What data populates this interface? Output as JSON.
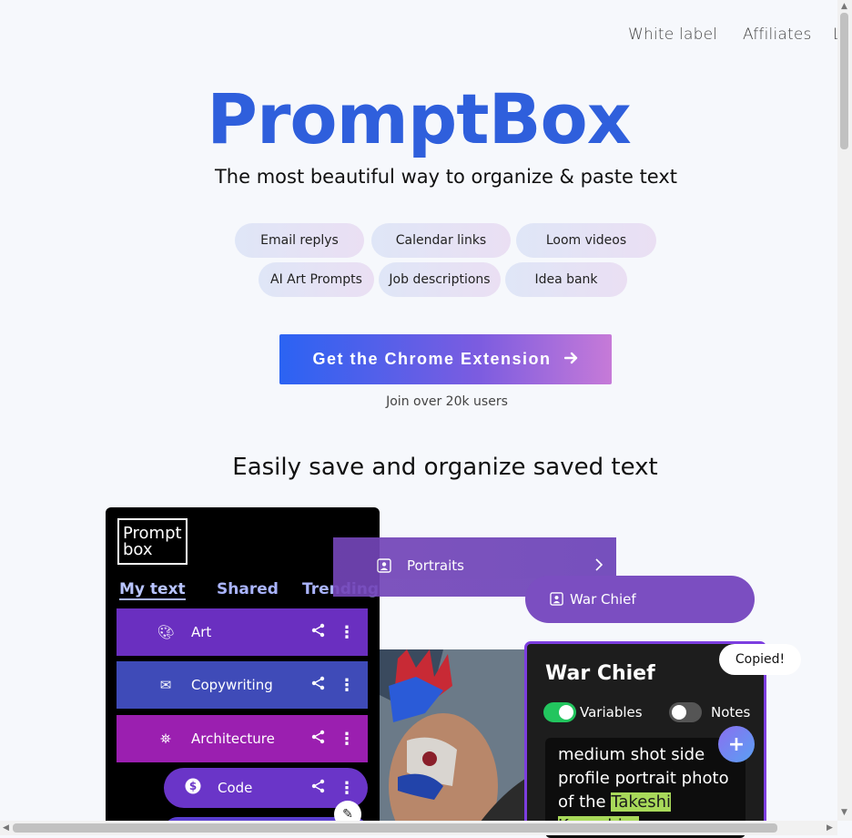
{
  "nav": {
    "items": [
      "White label",
      "Affiliates",
      "L"
    ]
  },
  "hero": {
    "logo": "PromptBox",
    "tagline": "The most beautiful way to organize & paste text",
    "chips_row1": [
      "Email replys",
      "Calendar links",
      "Loom videos"
    ],
    "chips_row2": [
      "AI Art Prompts",
      "Job descriptions",
      "Idea bank"
    ],
    "cta_label": "Get the Chrome Extension",
    "join_text": "Join over 20k users"
  },
  "section": {
    "title": "Easily save and organize saved text"
  },
  "demo": {
    "panel_logo": "Prompt box",
    "tabs": [
      "My text",
      "Shared",
      "Trending"
    ],
    "folders": [
      {
        "label": "Art",
        "icon": "palette-icon",
        "color": "#6a2fc0"
      },
      {
        "label": "Copywriting",
        "icon": "mail-icon",
        "color": "#3f4bb8"
      },
      {
        "label": "Architecture",
        "icon": "building-icon",
        "color": "#9b1fb0"
      },
      {
        "label": "Code",
        "icon": "dollar-icon",
        "color": "#6a35c8"
      }
    ],
    "portraits_label": "Portraits",
    "war_chief_pill": "War Chief",
    "card_title": "War Chief",
    "toggle_variables": "Variables",
    "toggle_notes": "Notes",
    "text_before": "medium shot side profile portrait photo of the",
    "text_highlight": "Takeshi Kaneshiro",
    "copied": "Copied!"
  },
  "colors": {
    "brand": "#2f5fdc",
    "accent_purple": "#7d3ee0",
    "toggle_on": "#22c55e",
    "highlight": "#a8d95a"
  }
}
